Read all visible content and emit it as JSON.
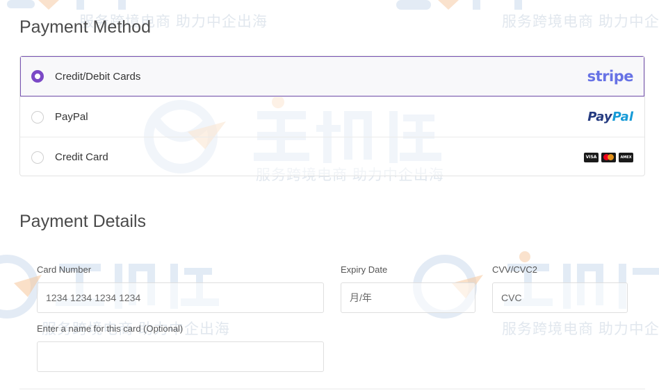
{
  "watermark": {
    "subtitle": "服务跨境电商 助力中企出海",
    "logo_color": "#c7d8ec",
    "accent_color": "#f5c69b"
  },
  "payment_method": {
    "title": "Payment Method",
    "selected_color": "#7b49c6",
    "options": [
      {
        "label": "Credit/Debit Cards",
        "logo": "stripe",
        "logo_text": "stripe",
        "selected": true
      },
      {
        "label": "PayPal",
        "logo": "paypal",
        "logo_text_1": "Pay",
        "logo_text_2": "Pal",
        "selected": false
      },
      {
        "label": "Credit Card",
        "logo": "card-brands",
        "brands": [
          "VISA",
          "mastercard",
          "AMEX"
        ],
        "selected": false
      }
    ]
  },
  "payment_details": {
    "title": "Payment Details",
    "card_number": {
      "label": "Card Number",
      "placeholder": "1234 1234 1234 1234",
      "value": ""
    },
    "expiry": {
      "label": "Expiry Date",
      "placeholder": "月/年",
      "value": ""
    },
    "cvv": {
      "label": "CVV/CVC2",
      "placeholder": "CVC",
      "value": ""
    },
    "card_name": {
      "label": "Enter a name for this card (Optional)",
      "placeholder": "",
      "value": ""
    }
  }
}
